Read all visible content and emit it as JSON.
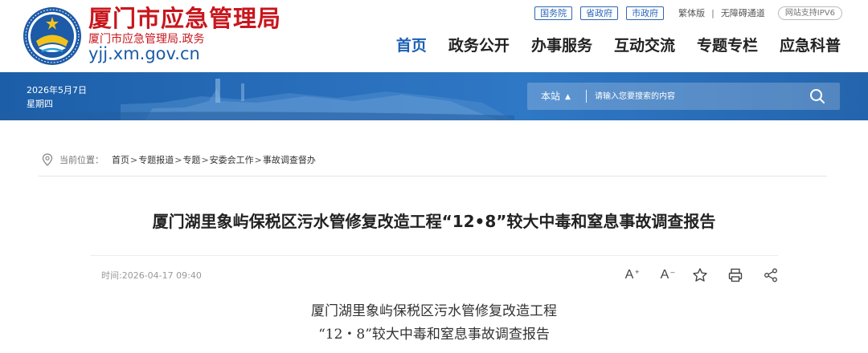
{
  "header": {
    "site_title": "厦门市应急管理局",
    "site_subtitle": "厦门市应急管理局.政务",
    "domain": "yjj.xm.gov.cn",
    "top_links": [
      "国务院",
      "省政府",
      "市政府"
    ],
    "traditional": "繁体版",
    "accessibility": "无障碍通道",
    "ipv6": "网站支持IPV6",
    "nav": [
      "首页",
      "政务公开",
      "办事服务",
      "互动交流",
      "专题专栏",
      "应急科普"
    ],
    "active_nav": "首页"
  },
  "banner": {
    "date": "2026年5月7日",
    "weekday": "星期四",
    "search_scope": "本站",
    "search_placeholder": "请输入您要搜索的内容"
  },
  "breadcrumb": {
    "label": "当前位置：",
    "items": [
      "首页",
      "专题报道",
      "专题",
      "安委会工作",
      "事故调查督办"
    ],
    "separator": ">"
  },
  "article": {
    "title": "厦门湖里象屿保税区污水管修复改造工程“12•8”较大中毒和窒息事故调查报告",
    "time": "时间:2026-04-17 09:40",
    "tools": [
      "A+",
      "A-",
      "star",
      "print",
      "share"
    ],
    "body_line1": "厦门湖里象屿保税区污水管修复改造工程",
    "body_line2": "“12・8”较大中毒和窒息事故调查报告"
  },
  "colors": {
    "brand_red": "#c8161d",
    "brand_blue": "#1b5fb3",
    "banner_blue": "#2a70bd"
  }
}
